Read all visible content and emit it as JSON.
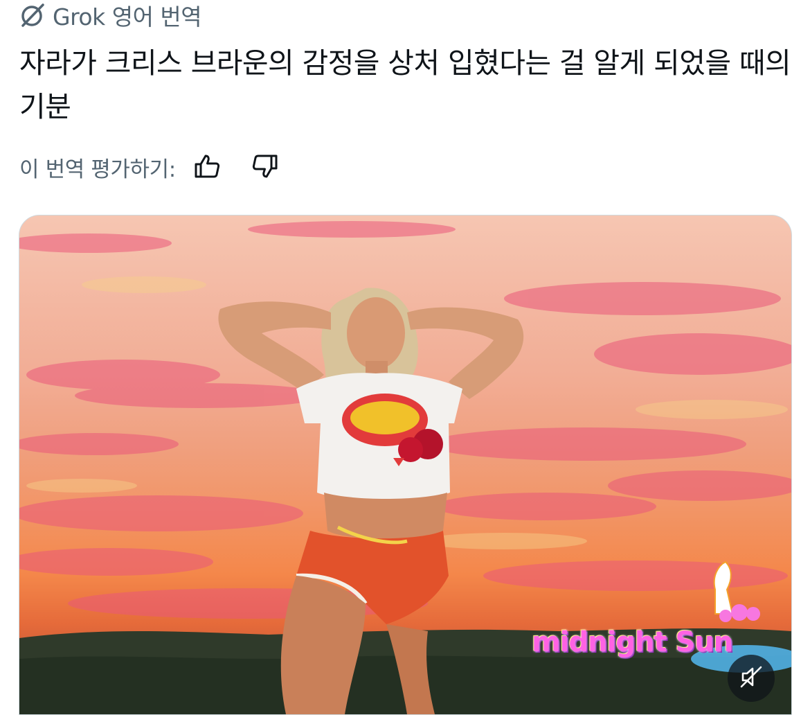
{
  "translation_header": {
    "provider_label": "Grok 영어 번역",
    "icon": "grok-logo-icon"
  },
  "post": {
    "text": "자라가 크리스 브라운의 감정을 상처 입혔다는 걸 알게 되었을 때의 기분"
  },
  "rating": {
    "prompt": "이 번역 평가하기:",
    "thumbs_up_icon": "thumbs-up-icon",
    "thumbs_down_icon": "thumbs-down-icon"
  },
  "media": {
    "type": "video",
    "overlay_logo_text": "midnight Sun",
    "mute_icon": "muted-speaker-icon",
    "colors": {
      "sky_top": "#f6c6b2",
      "sky_bottom": "#f4874a",
      "logo_pink": "#ff62e4"
    }
  }
}
